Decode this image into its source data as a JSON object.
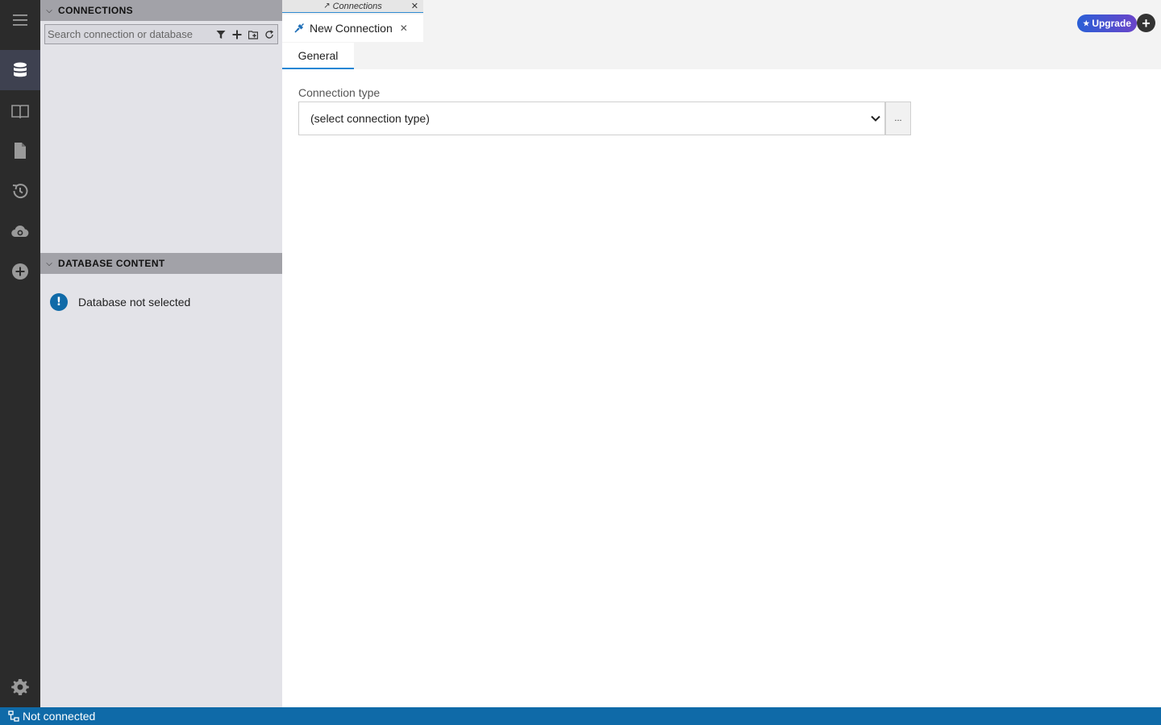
{
  "rail": {
    "items": [
      "menu",
      "connections",
      "documentation",
      "files",
      "history",
      "cloud",
      "add"
    ],
    "settings": "settings"
  },
  "sidebar": {
    "connections_header": "CONNECTIONS",
    "search_placeholder": "Search connection or database",
    "database_content_header": "DATABASE CONTENT",
    "database_message": "Database not selected"
  },
  "tabs": {
    "small_tab_label": "Connections",
    "active_tab_label": "New Connection",
    "sub_tab_label": "General"
  },
  "header": {
    "upgrade_label": "Upgrade",
    "plus_label": "+"
  },
  "form": {
    "connection_type_label": "Connection type",
    "connection_type_value": "(select connection type)",
    "more_button_label": "..."
  },
  "status": {
    "text": "Not connected"
  },
  "colors": {
    "accent": "#0f6aa8",
    "rail_bg": "#2b2b2b",
    "sidebar_bg": "#e3e3e8",
    "panel_header_bg": "#a2a2a8"
  }
}
